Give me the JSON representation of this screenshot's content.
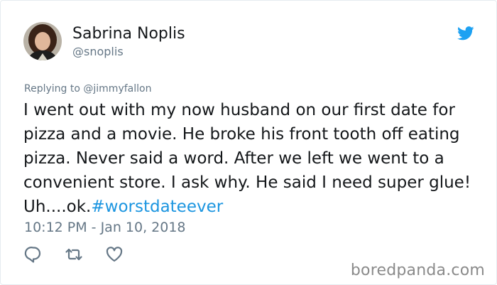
{
  "user": {
    "display_name": "Sabrina Noplis",
    "handle": "@snoplis"
  },
  "reply": {
    "prefix": "Replying to",
    "mention": "@jimmyfallon"
  },
  "tweet": {
    "text": "I went out with my now husband on our first date for pizza and a movie. He broke his front tooth off eating pizza. Never said a word. After we left we went to a convenient store. I ask why. He said I need super glue!  Uh....ok.",
    "hashtag": "#worstdateever",
    "timestamp": "10:12 PM - Jan 10, 2018"
  },
  "icons": {
    "brand": "twitter-bird-icon",
    "reply": "reply-icon",
    "retweet": "retweet-icon",
    "like": "heart-icon"
  },
  "colors": {
    "twitter_blue": "#1da1f2",
    "hashtag_blue": "#1b95e0",
    "secondary_text": "#657786",
    "primary_text": "#14171a"
  },
  "watermark": "boredpanda.com"
}
